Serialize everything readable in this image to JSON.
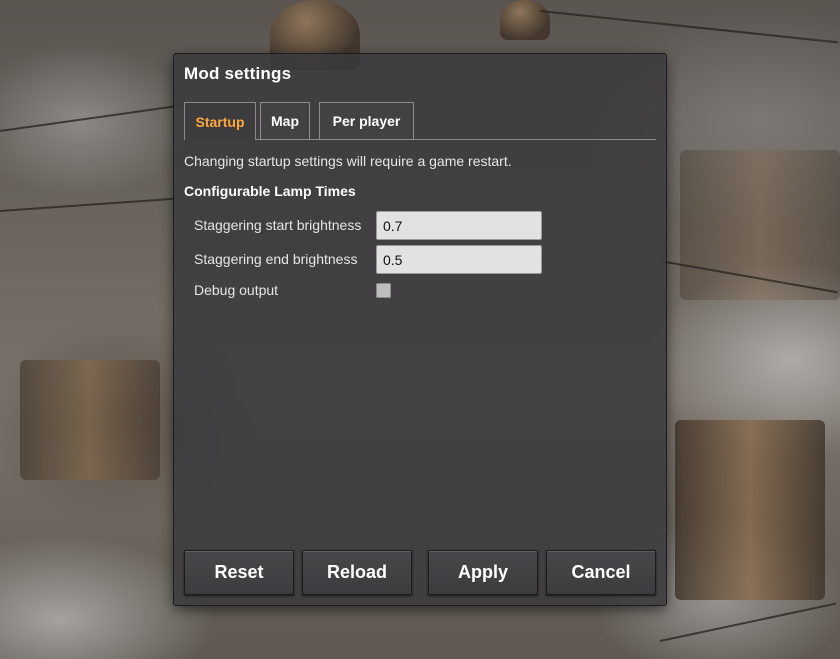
{
  "dialog": {
    "title": "Mod settings",
    "tabs": [
      {
        "label": "Startup",
        "active": true
      },
      {
        "label": "Map",
        "active": false
      },
      {
        "label": "Per player",
        "active": false
      }
    ],
    "notice": "Changing startup settings will require a game restart.",
    "section_title": "Configurable Lamp Times",
    "settings": [
      {
        "label": "Staggering start brightness",
        "value": "0.7"
      },
      {
        "label": "Staggering end brightness",
        "value": "0.5"
      },
      {
        "label": "Debug output",
        "checked": false
      }
    ],
    "buttons": {
      "reset": "Reset",
      "reload": "Reload",
      "apply": "Apply",
      "cancel": "Cancel"
    }
  },
  "colors": {
    "active_tab": "#ffa83a",
    "panel_bg": "#3a393c"
  }
}
